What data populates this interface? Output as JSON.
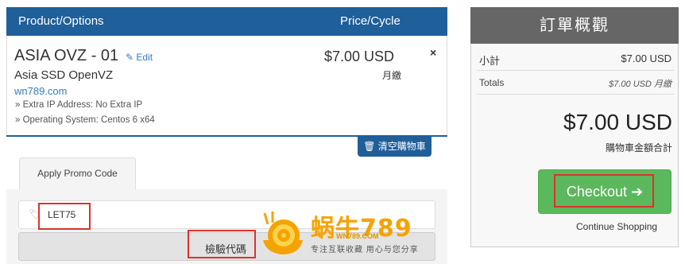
{
  "cart": {
    "header": {
      "product_options": "Product/Options",
      "price_cycle": "Price/Cycle"
    },
    "item": {
      "name": "ASIA OVZ - 01",
      "edit_label": "Edit",
      "group": "Asia SSD OpenVZ",
      "domain": "wn789.com",
      "options": [
        "» Extra IP Address: No Extra IP",
        "» Operating System: Centos 6 x64"
      ],
      "price": "$7.00 USD",
      "cycle": "月繳",
      "remove_symbol": "×"
    },
    "empty_cart_label": "清空購物車",
    "empty_cart_icon": "trash-icon"
  },
  "promo": {
    "tab_label": "Apply Promo Code",
    "code_value": "LET75",
    "validate_label": "檢驗代碼",
    "tag_icon": "tag-icon"
  },
  "summary": {
    "title": "訂單概觀",
    "subtotal_label": "小計",
    "subtotal_value": "$7.00 USD",
    "totals_label": "Totals",
    "totals_value": "$7.00 USD 月繳",
    "grand_total": "$7.00 USD",
    "grand_total_label": "購物車金額合計",
    "checkout_label": "Checkout",
    "checkout_icon": "arrow-right-icon",
    "continue_label": "Continue Shopping"
  },
  "watermark": {
    "brand": "蜗牛789",
    "url": "WN789.COM",
    "slogan": "专注互联收藏 用心与您分享"
  },
  "colors": {
    "primary": "#1f5f9a",
    "checkout_green": "#5cb85c",
    "summary_header": "#666666",
    "highlight_red": "#d9342b",
    "watermark_orange": "#f5a300"
  }
}
